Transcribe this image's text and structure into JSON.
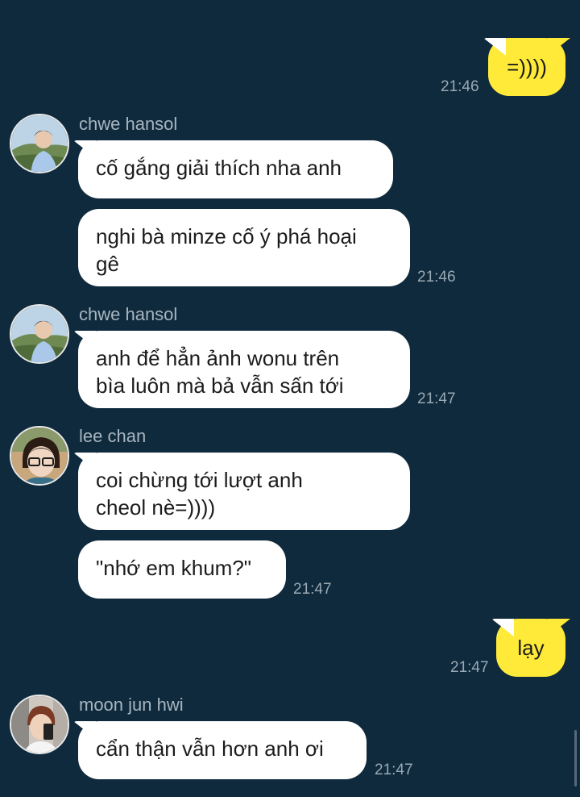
{
  "messages": [
    {
      "id": "m1",
      "side": "me",
      "text": "=))))",
      "time": "21:46"
    },
    {
      "id": "m2",
      "side": "other",
      "sender": "chwe hansol",
      "text": "cố gắng giải thích nha anh"
    },
    {
      "id": "m3",
      "side": "other",
      "sender": "chwe hansol",
      "text": "nghi bà minze cố ý phá hoại\ngê",
      "time": "21:46"
    },
    {
      "id": "m4",
      "side": "other",
      "sender": "chwe hansol",
      "text": "anh để hẳn ảnh wonu trên\nbìa luôn mà bả vẫn sấn tới",
      "time": "21:47"
    },
    {
      "id": "m5",
      "side": "other",
      "sender": "lee chan",
      "text": "coi chừng tới lượt anh\ncheol nè=))))"
    },
    {
      "id": "m6",
      "side": "other",
      "sender": "lee chan",
      "text": "\"nhớ em khum?\"",
      "time": "21:47"
    },
    {
      "id": "m7",
      "side": "me",
      "text": "lạy",
      "time": "21:47"
    },
    {
      "id": "m8",
      "side": "other",
      "sender": "moon jun hwi",
      "text": "cẩn thận vẫn hơn anh ơi",
      "time": "21:47"
    }
  ],
  "colors": {
    "background": "#0f2a3d",
    "my_bubble": "#ffea3a",
    "their_bubble": "#ffffff",
    "timestamp": "#9aa9b4"
  }
}
